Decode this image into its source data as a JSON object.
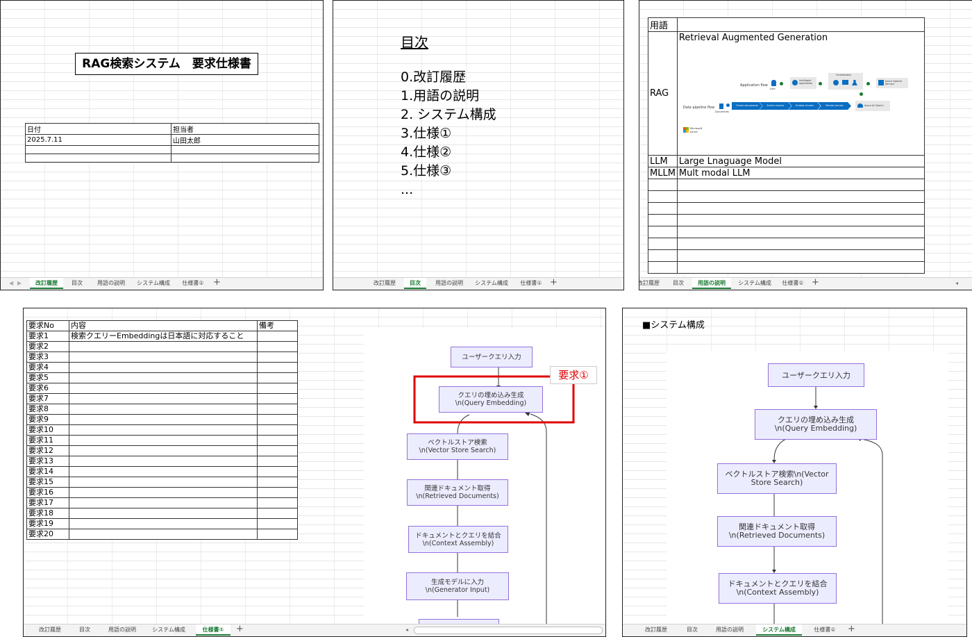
{
  "tabs": [
    "改訂履歴",
    "目次",
    "用語の説明",
    "システム構成",
    "仕様書①"
  ],
  "tab_plus": "+",
  "panel1": {
    "title": "RAG検索システム　要求仕様書",
    "table_headers": [
      "日付",
      "担当者"
    ],
    "table_row": [
      "2025.7.11",
      "山田太郎"
    ]
  },
  "panel2": {
    "heading": "目次",
    "items": [
      "0.改訂履歴",
      "1.用語の説明",
      "2. システム構成",
      "3.仕様①",
      "4.仕様②",
      "5.仕様③",
      "..."
    ]
  },
  "panel3": {
    "header": "用語",
    "rows": [
      {
        "term": "RAG",
        "desc": "Retrieval Augmented Generation"
      },
      {
        "term": "LLM",
        "desc": "Large Lnaguage Model"
      },
      {
        "term": "MLLM",
        "desc": "Mult modal LLM"
      }
    ],
    "diagram": {
      "app_flow": "Application flow",
      "pipeline_flow": "Data pipeline flow",
      "user": "User",
      "app_box": "Intelligent application",
      "orchestrator": "Orchestrator",
      "openai": "Azure OpenAI Service",
      "search": "Azure AI Search",
      "documents": "Documents",
      "steps": [
        "Chunk documents",
        "Enrich chunks",
        "Embed chunks",
        "Persist chunks"
      ],
      "ms": "Microsoft Azure"
    }
  },
  "panel4": {
    "headers": [
      "要求No",
      "内容",
      "備考"
    ],
    "rows": [
      [
        "要求1",
        "検索クエリーEmbeddingは日本語に対応すること"
      ],
      [
        "要求2",
        ""
      ],
      [
        "要求3",
        ""
      ],
      [
        "要求4",
        ""
      ],
      [
        "要求5",
        ""
      ],
      [
        "要求6",
        ""
      ],
      [
        "要求7",
        ""
      ],
      [
        "要求8",
        ""
      ],
      [
        "要求9",
        ""
      ],
      [
        "要求10",
        ""
      ],
      [
        "要求11",
        ""
      ],
      [
        "要求12",
        ""
      ],
      [
        "要求13",
        ""
      ],
      [
        "要求14",
        ""
      ],
      [
        "要求15",
        ""
      ],
      [
        "要求16",
        ""
      ],
      [
        "要求17",
        ""
      ],
      [
        "要求18",
        ""
      ],
      [
        "要求19",
        ""
      ],
      [
        "要求20",
        ""
      ]
    ],
    "callout": "要求①"
  },
  "panel5": {
    "heading": "■システム構成"
  },
  "flow": {
    "n1": "ユーザークエリ入力",
    "n2": "クエリの埋め込み生成\\n(Query Embedding)",
    "n3": "ベクトルストア検索\\n(Vector Store Search)",
    "n4": "関連ドキュメント取得\\n(Retrieved Documents)",
    "n5": "ドキュメントとクエリを結合\\n(Context Assembly)",
    "n6": "生成モデルに入力\\n(Generator Input)"
  },
  "colors": {
    "active_tab": "#1a7a33",
    "callout": "#e00000",
    "node_fill": "#ececff",
    "node_border": "#9370db",
    "azure": "#0a6ec2"
  }
}
